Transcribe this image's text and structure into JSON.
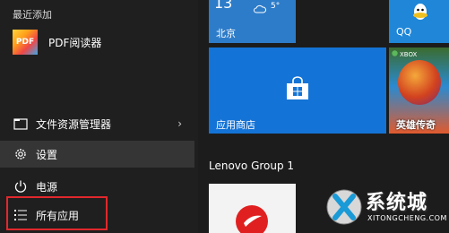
{
  "start_menu": {
    "recently_added_label": "最近添加",
    "recent_app": {
      "name": "PDF阅读器",
      "icon": "pdf-reader-icon",
      "icon_text": "PDF"
    },
    "nav": {
      "file_explorer": {
        "label": "文件资源管理器",
        "icon": "folder-icon"
      },
      "settings": {
        "label": "设置",
        "icon": "gear-icon"
      },
      "power": {
        "label": "电源",
        "icon": "power-icon"
      },
      "all_apps": {
        "label": "所有应用",
        "icon": "list-icon"
      }
    },
    "highlight_color": "#e1282c"
  },
  "tiles": {
    "weather": {
      "temp": "13",
      "low": "5°",
      "city": "北京",
      "color": "#2d7cc9"
    },
    "qq": {
      "label": "QQ",
      "color": "#1f86d8"
    },
    "store": {
      "label": "应用商店",
      "icon": "store-bag-icon",
      "color": "#1473d6"
    },
    "xbox_game": {
      "badge": "XBOX",
      "title": "英雄传奇"
    },
    "group_title": "Lenovo Group 1"
  },
  "watermark": {
    "text": "系统城",
    "sub": "XITONGCHENG.COM"
  }
}
